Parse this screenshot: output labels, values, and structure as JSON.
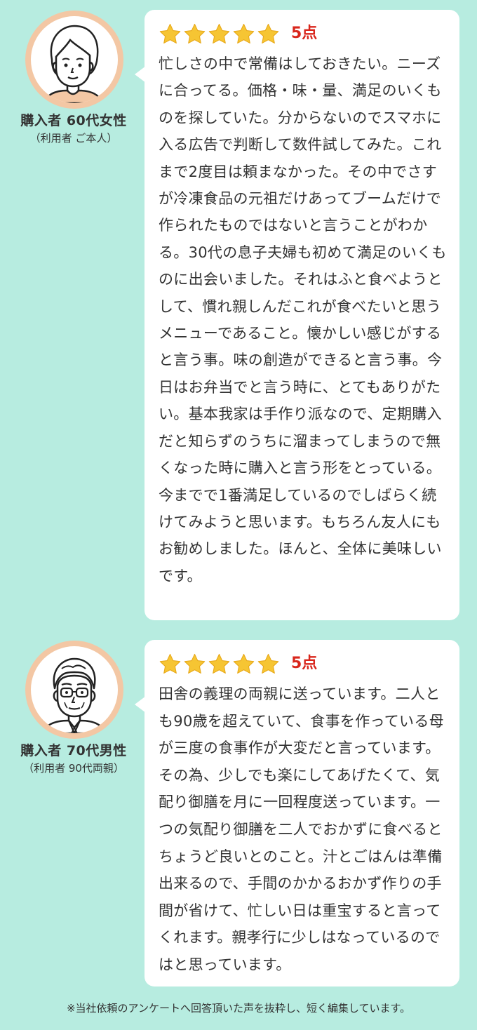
{
  "colors": {
    "background": "#b7ece0",
    "card": "#ffffff",
    "star": "#f6c533",
    "rating_text": "#d9261c",
    "avatar_ring": "#f3c7a4"
  },
  "reviews": [
    {
      "avatar_icon": "elderly-woman-avatar-icon",
      "persona_title": "購入者 60代女性",
      "persona_sub": "（利用者 ご本人）",
      "stars": 5,
      "rating_label": "5点",
      "text": "忙しさの中で常備はしておきたい。ニーズに合ってる。価格・味・量、満足のいくものを探していた。分からないのでスマホに入る広告で判断して数件試してみた。これまで2度目は頼まなかった。その中でさすが冷凍食品の元祖だけあってブームだけで作られたものではないと言うことがわかる。30代の息子夫婦も初めて満足のいくものに出会いました。それはふと食べようとして、慣れ親しんだこれが食べたいと思うメニューであること。懐かしい感じがすると言う事。味の創造ができると言う事。今日はお弁当でと言う時に、とてもありがたい。基本我家は手作り派なので、定期購入だと知らずのうちに溜まってしまうので無くなった時に購入と言う形をとっている。\n今までで1番満足しているのでしばらく続けてみようと思います。もちろん友人にもお勧めしました。ほんと、全体に美味しいです。"
    },
    {
      "avatar_icon": "elderly-man-avatar-icon",
      "persona_title": "購入者 70代男性",
      "persona_sub": "（利用者 90代両親）",
      "stars": 5,
      "rating_label": "5点",
      "text": "田舎の義理の両親に送っています。二人とも90歳を超えていて、食事を作っている母が三度の食事作が大変だと言っています。その為、少しでも楽にしてあげたくて、気配り御膳を月に一回程度送っています。一つの気配り御膳を二人でおかずに食べるとちょうど良いとのこと。汁とごはんは準備出来るので、手間のかかるおかず作りの手間が省けて、忙しい日は重宝すると言ってくれます。親孝行に少しはなっているのではと思っています。"
    }
  ],
  "footnote": "※当社依頼のアンケートへ回答頂いた声を抜粋し、短く編集しています。"
}
